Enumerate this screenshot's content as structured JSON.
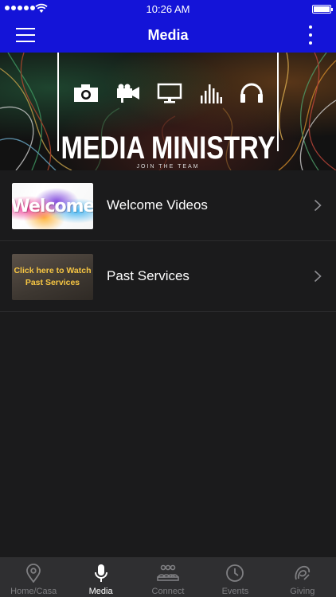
{
  "status_bar": {
    "time": "10:26 AM"
  },
  "nav": {
    "title": "Media"
  },
  "banner": {
    "title": "MEDIA MINISTRY",
    "subtitle": "JOIN THE TEAM"
  },
  "list": {
    "items": [
      {
        "label": "Welcome Videos",
        "thumbnail_text": "Welcome"
      },
      {
        "label": "Past Services",
        "thumbnail_text": "Click here to Watch Past Services"
      }
    ]
  },
  "tabs": [
    {
      "label": "Home/Casa",
      "icon": "location-pin-icon",
      "active": false
    },
    {
      "label": "Media",
      "icon": "microphone-icon",
      "active": true
    },
    {
      "label": "Connect",
      "icon": "group-icon",
      "active": false
    },
    {
      "label": "Events",
      "icon": "clock-icon",
      "active": false
    },
    {
      "label": "Giving",
      "icon": "giving-icon",
      "active": false
    }
  ],
  "colors": {
    "brand": "#1414d8",
    "background": "#1b1b1c",
    "tab_bar": "#2f2f31",
    "tab_inactive": "#7f7f82",
    "thumb_accent": "#f6c543"
  }
}
